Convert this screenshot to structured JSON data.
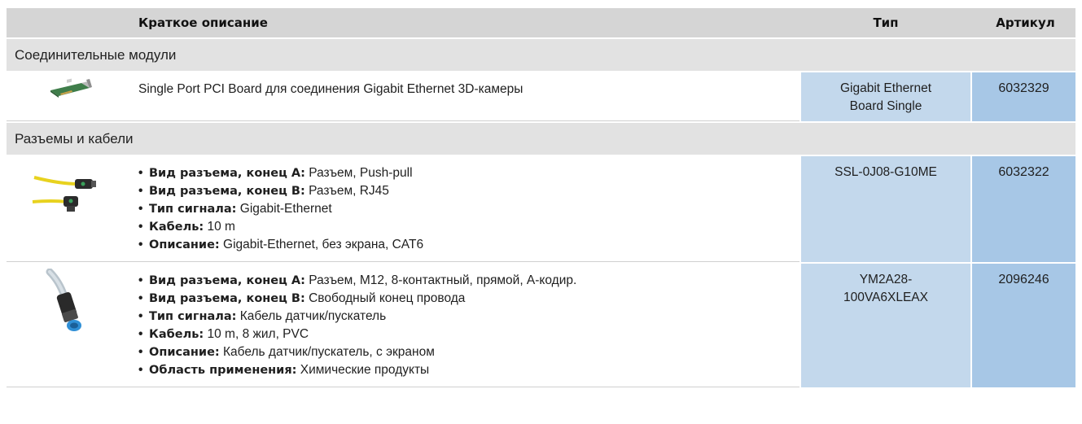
{
  "header": {
    "description": "Краткое описание",
    "type": "Тип",
    "article": "Артикул"
  },
  "groups": [
    {
      "title": "Соединительные модули",
      "rows": [
        {
          "image_icon": "pci-board-icon",
          "description": "Single Port PCI Board для соединения Gigabit Ethernet 3D-камеры",
          "type_lines": [
            "Gigabit Ethernet",
            "Board Single"
          ],
          "article": "6032329"
        }
      ]
    },
    {
      "title": "Разъемы и кабели",
      "rows": [
        {
          "image_icon": "ethernet-cable-icon",
          "specs": [
            {
              "label": "Вид разъема, конец А:",
              "value": "Разъем, Push-pull"
            },
            {
              "label": "Вид разъема, конец B:",
              "value": "Разъем, RJ45"
            },
            {
              "label": "Тип сигнала:",
              "value": "Gigabit-Ethernet"
            },
            {
              "label": "Кабель:",
              "value": "10 m"
            },
            {
              "label": "Описание:",
              "value": "Gigabit-Ethernet, без экрана, CAT6"
            }
          ],
          "type_lines": [
            "SSL-0J08-G10ME"
          ],
          "article": "6032322"
        },
        {
          "image_icon": "m12-connector-icon",
          "specs": [
            {
              "label": "Вид разъема, конец А:",
              "value": "Разъем, M12, 8-контактный, прямой, A-кодир."
            },
            {
              "label": "Вид разъема, конец B:",
              "value": "Свободный конец провода"
            },
            {
              "label": "Тип сигнала:",
              "value": "Кабель датчик/пускатель"
            },
            {
              "label": "Кабель:",
              "value": "10 m, 8 жил, PVC"
            },
            {
              "label": "Описание:",
              "value": "Кабель датчик/пускатель, с экраном"
            },
            {
              "label": "Область применения:",
              "value": "Химические продукты"
            }
          ],
          "type_lines": [
            "YM2A28-",
            "100VA6XLEAX"
          ],
          "article": "2096246"
        }
      ]
    }
  ]
}
